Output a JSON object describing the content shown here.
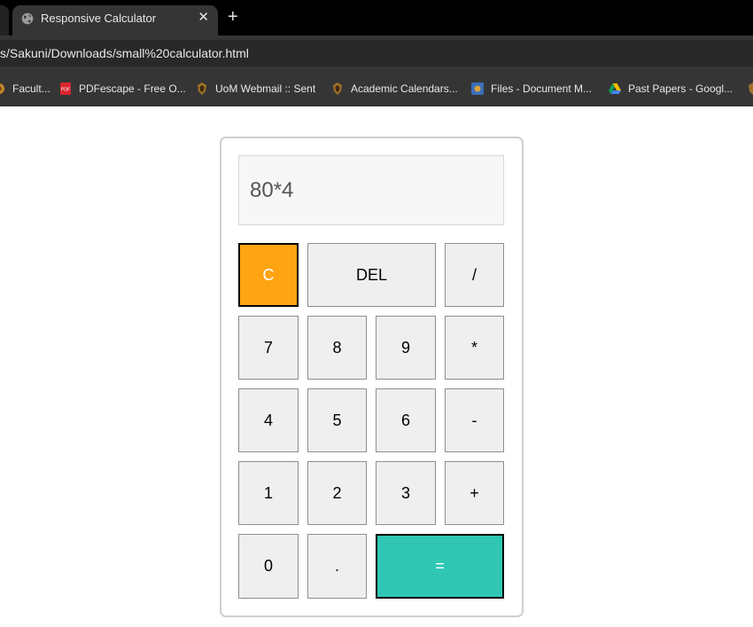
{
  "browser": {
    "tab_title": "Responsive Calculator",
    "close_glyph": "✕",
    "new_tab_glyph": "+",
    "url": "s/Sakuni/Downloads/small%20calculator.html",
    "bookmarks": [
      {
        "label": "Facult...",
        "icon": "faculty-icon"
      },
      {
        "label": "PDFescape - Free O...",
        "icon": "pdf-icon"
      },
      {
        "label": "UoM Webmail :: Sent",
        "icon": "uom-crest-icon"
      },
      {
        "label": "Academic Calendars...",
        "icon": "uom-crest-icon"
      },
      {
        "label": "Files - Document M...",
        "icon": "files-icon"
      },
      {
        "label": "Past Papers - Googl...",
        "icon": "google-drive-icon"
      }
    ]
  },
  "calculator": {
    "display": "80*4",
    "keys": {
      "clear": "C",
      "del": "DEL",
      "divide": "/",
      "seven": "7",
      "eight": "8",
      "nine": "9",
      "multiply": "*",
      "four": "4",
      "five": "5",
      "six": "6",
      "minus": "-",
      "one": "1",
      "two": "2",
      "three": "3",
      "plus": "+",
      "zero": "0",
      "dot": ".",
      "equals": "="
    },
    "colors": {
      "clear": "#ffa412",
      "equals": "#2fc7b4",
      "key": "#efefef"
    }
  }
}
